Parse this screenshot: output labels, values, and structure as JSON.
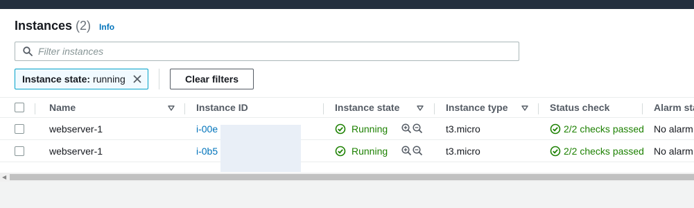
{
  "header": {
    "title": "Instances",
    "count": "(2)",
    "info": "Info"
  },
  "search": {
    "placeholder": "Filter instances",
    "value": ""
  },
  "filter_token": {
    "key": "Instance state:",
    "value": "running"
  },
  "toolbar": {
    "clear_filters": "Clear filters"
  },
  "columns": [
    "Name",
    "Instance ID",
    "Instance state",
    "Instance type",
    "Status check",
    "Alarm sta"
  ],
  "rows": [
    {
      "name": "webserver-1",
      "instance_id": "i-00e",
      "state": "Running",
      "type": "t3.micro",
      "status": "2/2 checks passed",
      "alarm": "No alarm"
    },
    {
      "name": "webserver-1",
      "instance_id": "i-0b5",
      "state": "Running",
      "type": "t3.micro",
      "status": "2/2 checks passed",
      "alarm": "No alarm"
    }
  ],
  "colors": {
    "topbar": "#232f3e",
    "link": "#0073bb",
    "success": "#1d8102",
    "token_border": "#00a1c9"
  }
}
